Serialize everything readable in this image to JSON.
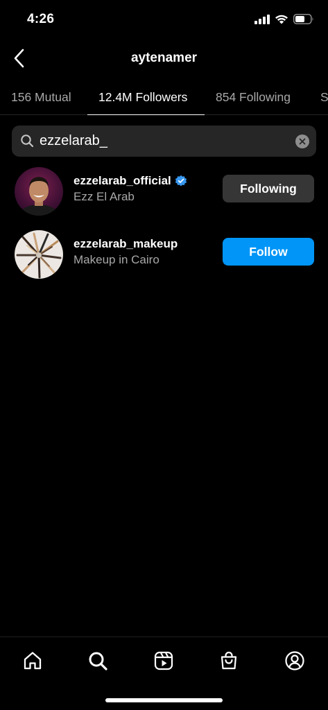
{
  "status_bar": {
    "time": "4:26"
  },
  "header": {
    "title": "aytenamer"
  },
  "tabs": [
    {
      "label": "156 Mutual",
      "active": false
    },
    {
      "label": "12.4M Followers",
      "active": true
    },
    {
      "label": "854 Following",
      "active": false
    },
    {
      "label": "S",
      "active": false
    }
  ],
  "search": {
    "value": "ezzelarab_"
  },
  "results": [
    {
      "username": "ezzelarab_official",
      "full_name": "Ezz El Arab",
      "verified": true,
      "button_label": "Following",
      "button_style": "secondary"
    },
    {
      "username": "ezzelarab_makeup",
      "full_name": "Makeup in Cairo",
      "verified": false,
      "button_label": "Follow",
      "button_style": "primary"
    }
  ],
  "bottom_nav": [
    "home-icon",
    "search-icon",
    "reels-icon",
    "shop-icon",
    "profile-icon"
  ],
  "colors": {
    "background": "#000000",
    "accent": "#0095f6",
    "verified": "#3797f0",
    "secondary_button": "#363636"
  }
}
